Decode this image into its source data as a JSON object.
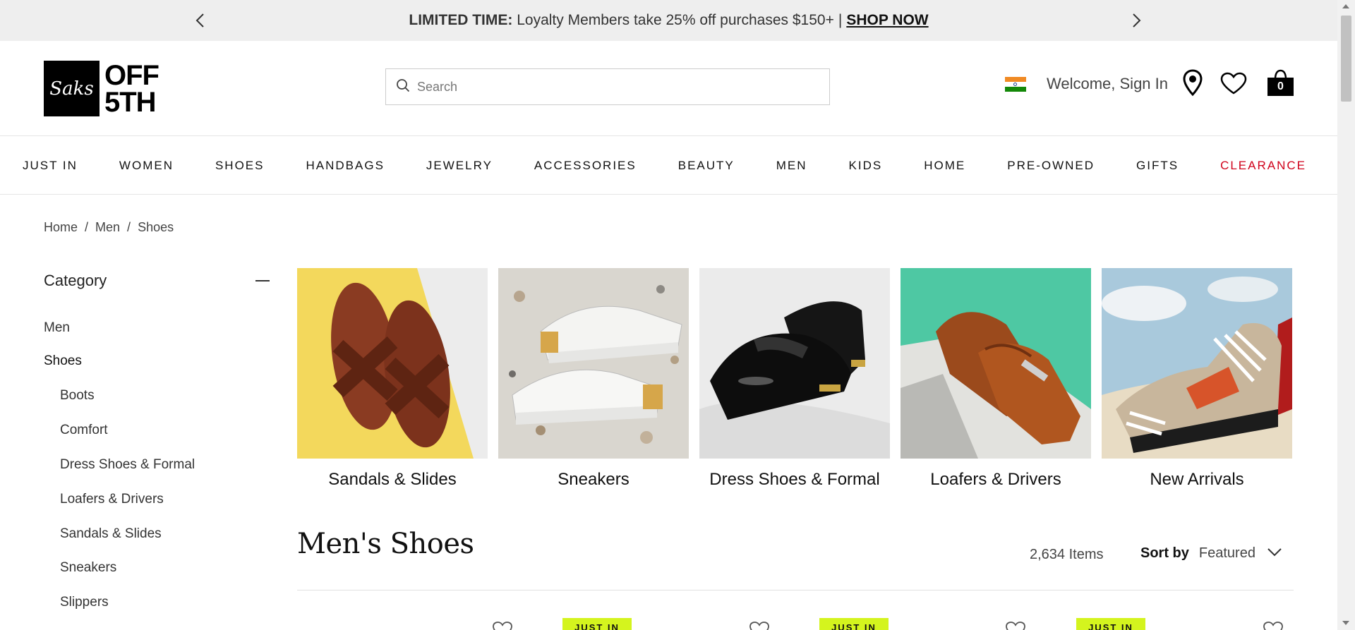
{
  "promo": {
    "bold": "LIMITED TIME:",
    "text": "Loyalty Members take 25% off purchases $150+",
    "separator": "|",
    "link": "SHOP NOW"
  },
  "header": {
    "logo_word_1": "OFF",
    "logo_word_2": "5TH",
    "logo_script": "Saks",
    "search_placeholder": "Search",
    "welcome": "Welcome, Sign In",
    "bag_count": "0"
  },
  "nav": [
    "JUST IN",
    "WOMEN",
    "SHOES",
    "HANDBAGS",
    "JEWELRY",
    "ACCESSORIES",
    "BEAUTY",
    "MEN",
    "KIDS",
    "HOME",
    "PRE-OWNED",
    "GIFTS",
    "CLEARANCE"
  ],
  "breadcrumb": [
    "Home",
    "Men",
    "Shoes"
  ],
  "sidebar": {
    "title": "Category",
    "men": "Men",
    "shoes": "Shoes",
    "subs": [
      "Boots",
      "Comfort",
      "Dress Shoes & Formal",
      "Loafers & Drivers",
      "Sandals & Slides",
      "Sneakers",
      "Slippers"
    ]
  },
  "tiles": [
    "Sandals & Slides",
    "Sneakers",
    "Dress Shoes & Formal",
    "Loafers & Drivers",
    "New Arrivals"
  ],
  "listing": {
    "title": "Men's Shoes",
    "count": "2,634 Items",
    "sort_label": "Sort by",
    "sort_value": "Featured",
    "badge": "JUST IN"
  },
  "colors": {
    "clearance": "#d0021b",
    "badge": "#d4f41e",
    "promo_bg": "#eeeeee"
  }
}
